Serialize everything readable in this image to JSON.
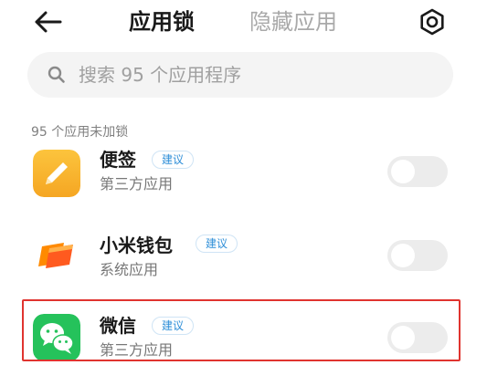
{
  "header": {
    "tab_active": "应用锁",
    "tab_inactive": "隐藏应用"
  },
  "search": {
    "placeholder": "搜索 95 个应用程序"
  },
  "section": {
    "label": "95 个应用未加锁"
  },
  "apps": [
    {
      "name": "便签",
      "badge": "建议",
      "type": "第三方应用",
      "icon": "notes-app-icon",
      "locked": false
    },
    {
      "name": "小米钱包",
      "badge": "建议",
      "type": "系统应用",
      "icon": "mi-wallet-app-icon",
      "locked": false
    },
    {
      "name": "微信",
      "badge": "建议",
      "type": "第三方应用",
      "icon": "wechat-app-icon",
      "locked": false
    }
  ],
  "colors": {
    "accent": "#2f8fd8",
    "highlight": "#e0342f",
    "notes": "#f9b62c",
    "wechat": "#25c25b",
    "wallet": "#ff6a00"
  }
}
